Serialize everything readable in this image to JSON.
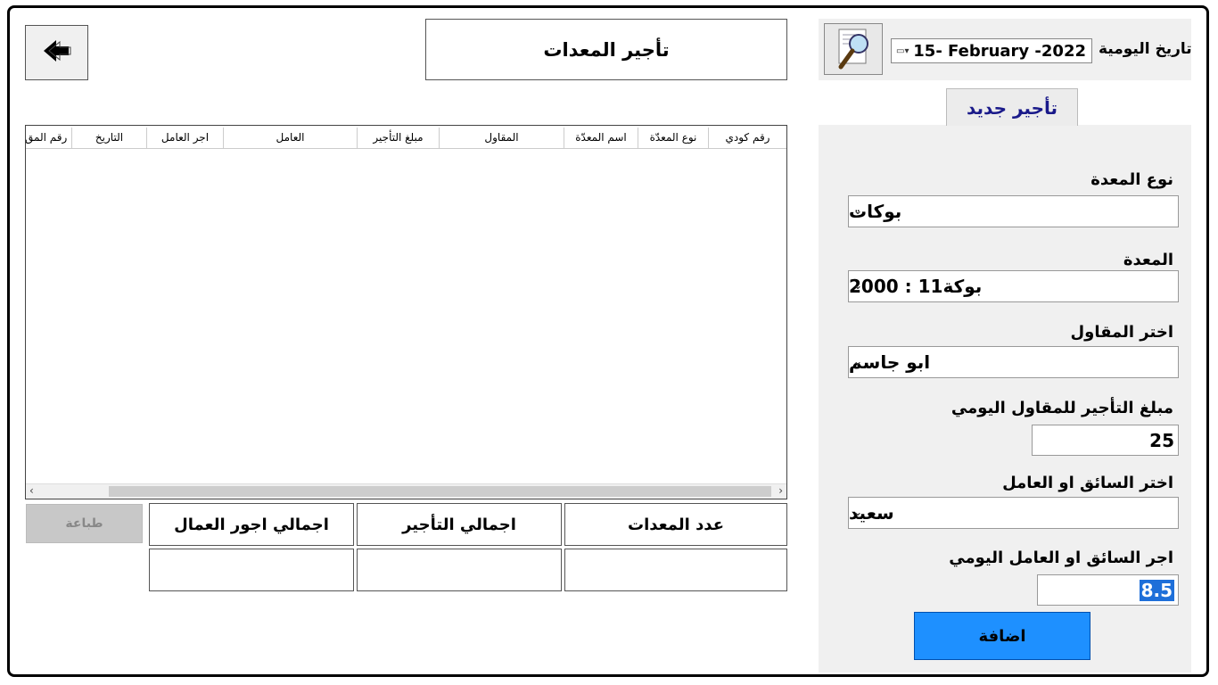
{
  "header": {
    "title": "تأجير المعدات",
    "back_label": "back"
  },
  "date_panel": {
    "label": "تاريخ اليومية",
    "value": "15- February  -2022"
  },
  "tab": {
    "label": "تأجير جديد"
  },
  "form": {
    "equipment_type_label": "نوع المعدة",
    "equipment_type_value": "بوكات",
    "equipment_label": "المعدة",
    "equipment_value": "بوكة11 : 2000",
    "contractor_label": "اختر المقاول",
    "contractor_value": "ابو جاسم",
    "rent_label": "مبلغ التأجير للمقاول اليومي",
    "rent_value": "25",
    "driver_label": "اختر السائق او العامل",
    "driver_value": "سعيد",
    "wage_label": "اجر السائق او العامل اليومي",
    "wage_value": "8.5",
    "add_label": "اضافة"
  },
  "grid": {
    "columns": [
      "رقم كودي",
      "نوع المعدّة",
      "اسم المعدّة",
      "المقاول",
      "مبلغ التأجير",
      "العامل",
      "اجر العامل",
      "التاريخ",
      "رقم المق"
    ]
  },
  "summary": {
    "count_label": "عدد المعدات",
    "rent_total_label": "اجمالي التأجير",
    "wages_total_label": "اجمالي اجور العمال",
    "print_label": "طباعة"
  }
}
